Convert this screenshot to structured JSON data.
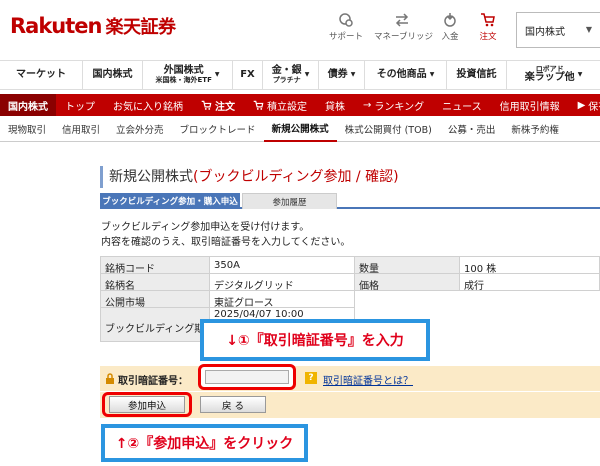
{
  "header": {
    "logo_en": "Rakuten",
    "logo_ja": "楽天証券",
    "icons": [
      {
        "name": "support-icon",
        "label": "サポート"
      },
      {
        "name": "money-bridge-icon",
        "label": "マネーブリッジ"
      },
      {
        "name": "deposit-icon",
        "label": "入金"
      },
      {
        "name": "cart-icon",
        "label": "注文"
      }
    ],
    "market_select": "国内株式"
  },
  "main_nav": [
    {
      "label": "マーケット",
      "sub": "",
      "dropdown": false
    },
    {
      "label": "国内株式",
      "sub": "",
      "dropdown": false
    },
    {
      "label": "外国株式",
      "sub": "米国株・海外ETF",
      "dropdown": true
    },
    {
      "label": "FX",
      "sub": "",
      "dropdown": false
    },
    {
      "label": "金・銀",
      "sub": "プラチナ",
      "dropdown": true
    },
    {
      "label": "債券",
      "sub": "",
      "dropdown": true
    },
    {
      "label": "その他商品",
      "sub": "",
      "dropdown": true
    },
    {
      "label": "投資信託",
      "sub": "",
      "dropdown": false
    },
    {
      "label": "ロボアド",
      "sub": "楽ラップ他",
      "dropdown": true
    }
  ],
  "red_nav": [
    "国内株式",
    "トップ",
    "お気に入り銘柄",
    "注文",
    "積立設定",
    "貸株",
    "ランキング",
    "ニュース",
    "信用取引情報",
    "保有商"
  ],
  "sub_nav": [
    "現物取引",
    "信用取引",
    "立会外分売",
    "ブロックトレード",
    "新規公開株式",
    "株式公開買付 (TOB)",
    "公募・売出",
    "新株予約権"
  ],
  "page": {
    "title": "新規公開株式",
    "title_highlight": "(ブックビルディング参加 / 確認)",
    "tabs": [
      "ブックビルディング参加・購入申込",
      "参加履歴"
    ],
    "message_line1": "ブックビルディング参加申込を受け付けます。",
    "message_line2": "内容を確認のうえ、取引暗証番号を入力してください。",
    "info": {
      "code_label": "銘柄コード",
      "code_value": "350A",
      "qty_label": "数量",
      "qty_value": "100 株",
      "name_label": "銘柄名",
      "name_value": "デジタルグリッド",
      "price_label": "価格",
      "price_value": "成行",
      "market_label": "公開市場",
      "market_value": "東証グロース",
      "period_label": "ブックビルディング期間",
      "period_value": "2025/04/07 10:00"
    },
    "pin_label": "取引暗証番号：",
    "pin_help_link": "取引暗証番号とは？",
    "submit_label": "参加申込",
    "back_label": "戻 る"
  },
  "callouts": {
    "step1": "↓①『取引暗証番号』を入力",
    "step2": "↑②『参加申込』をクリック"
  },
  "colors": {
    "brand_red": "#bf0000",
    "callout_border": "#2b95e0",
    "callout_text": "#e0001b",
    "tab_blue": "#4a76b8",
    "pin_bg": "#fbeac7"
  }
}
